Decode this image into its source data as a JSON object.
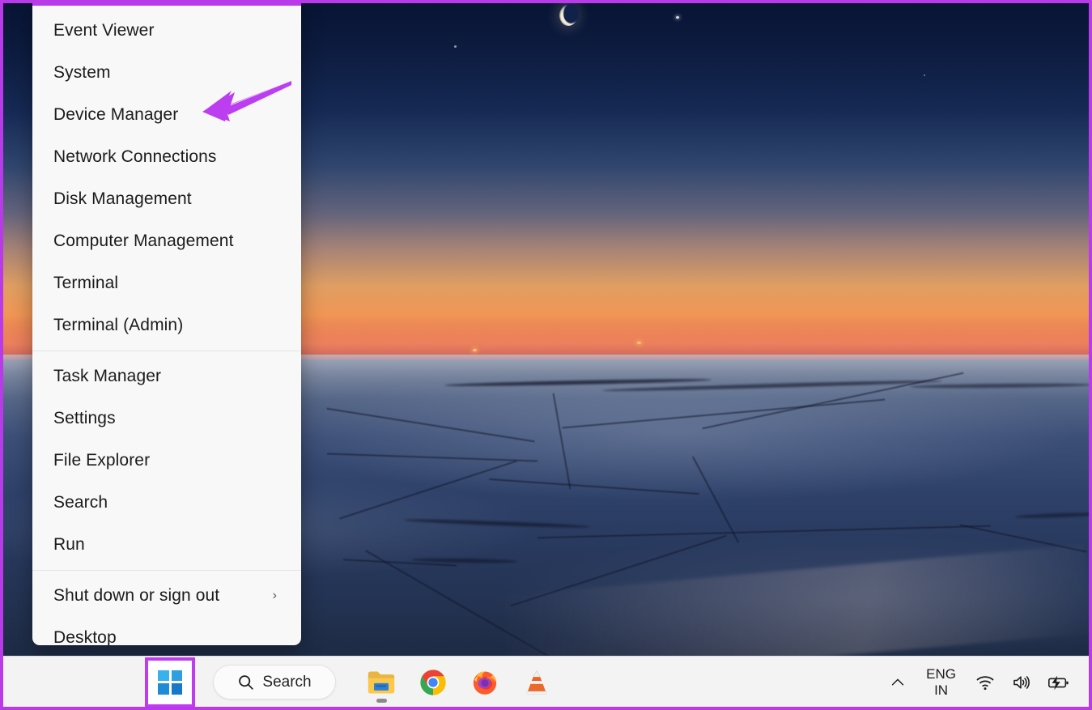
{
  "annotation": {
    "border_color": "#b83ae8",
    "arrow_color": "#bb3ef0",
    "highlight_color": "#c03bf0",
    "arrow_points_to": "Device Manager",
    "highlight_target": "start-button"
  },
  "desktop": {
    "wallpaper_description": "Snowy countryside at dusk with crescent moon and orange sunset horizon"
  },
  "context_menu": {
    "name": "Windows power user menu (Win+X)",
    "groups": [
      {
        "items": [
          {
            "label": "Event Viewer",
            "has_submenu": false
          },
          {
            "label": "System",
            "has_submenu": false
          },
          {
            "label": "Device Manager",
            "has_submenu": false
          },
          {
            "label": "Network Connections",
            "has_submenu": false
          },
          {
            "label": "Disk Management",
            "has_submenu": false
          },
          {
            "label": "Computer Management",
            "has_submenu": false
          },
          {
            "label": "Terminal",
            "has_submenu": false
          },
          {
            "label": "Terminal (Admin)",
            "has_submenu": false
          }
        ]
      },
      {
        "items": [
          {
            "label": "Task Manager",
            "has_submenu": false
          },
          {
            "label": "Settings",
            "has_submenu": false
          },
          {
            "label": "File Explorer",
            "has_submenu": false
          },
          {
            "label": "Search",
            "has_submenu": false
          },
          {
            "label": "Run",
            "has_submenu": false
          }
        ]
      },
      {
        "items": [
          {
            "label": "Shut down or sign out",
            "has_submenu": true,
            "chevron": "›"
          },
          {
            "label": "Desktop",
            "has_submenu": false
          }
        ]
      }
    ]
  },
  "taskbar": {
    "start_button": {
      "icon": "windows-logo-icon",
      "highlighted": true
    },
    "search": {
      "label": "Search",
      "icon": "search-icon"
    },
    "apps": [
      {
        "name": "File Explorer",
        "icon": "file-explorer-icon",
        "running": true
      },
      {
        "name": "Google Chrome",
        "icon": "chrome-icon",
        "running": false
      },
      {
        "name": "Mozilla Firefox",
        "icon": "firefox-icon",
        "running": false
      },
      {
        "name": "VLC media player",
        "icon": "vlc-cone-icon",
        "running": false
      }
    ],
    "tray": {
      "overflow": {
        "icon": "chevron-up-icon"
      },
      "language": {
        "line1": "ENG",
        "line2": "IN"
      },
      "network": {
        "icon": "wifi-icon"
      },
      "volume": {
        "icon": "speaker-icon"
      },
      "battery": {
        "icon": "battery-charging-icon"
      }
    }
  }
}
